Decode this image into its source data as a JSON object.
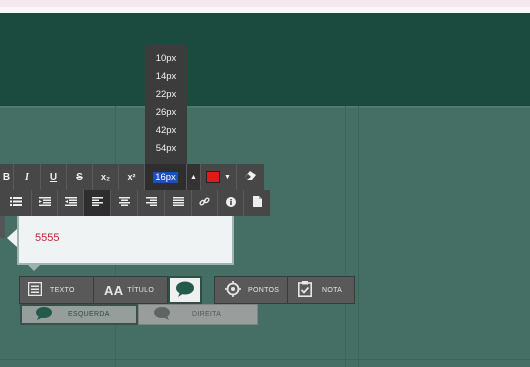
{
  "font_size_menu": {
    "options": [
      "10px",
      "14px",
      "22px",
      "26px",
      "42px",
      "54px"
    ],
    "selected": "16px"
  },
  "toolbar_row1": {
    "bold": "B",
    "italic": "I",
    "underline": "U",
    "strike": "S",
    "subscript": "x₂",
    "superscript": "x²",
    "font_size": "16px",
    "dropdown_arrow": "▲",
    "color_arrow": "▼",
    "text_color": "#dc1c1c"
  },
  "bubble": {
    "text": "5555"
  },
  "type_selector": {
    "texto": "TEXTO",
    "titulo": "TÍTULO",
    "pontos": "PONTOS",
    "nota": "NOTA"
  },
  "align_selector": {
    "esquerda": "ESQUERDA",
    "direita": "DIREITA"
  }
}
